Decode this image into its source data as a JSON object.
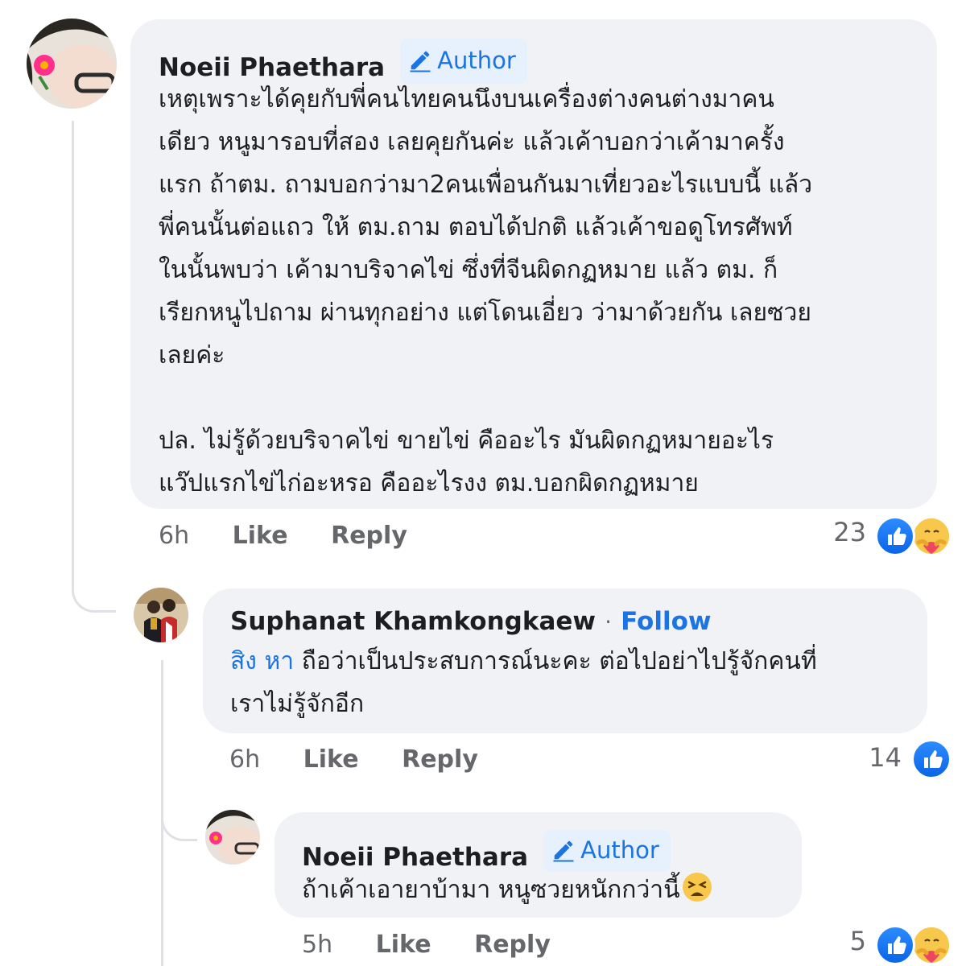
{
  "comments": [
    {
      "author": "Noeii Phaethara",
      "badge": "Author",
      "text": "เหตุเพราะได้คุยกับพี่คนไทยคนนึงบนเครื่องต่างคนต่างมาคน\nเดียว หนูมารอบที่สอง เลยคุยกันค่ะ แล้วเค้าบอกว่าเค้ามาครั้ง\nแรก ถ้าตม. ถามบอกว่ามา2คนเพื่อนกันมาเที่ยวอะไรแบบนี้ แล้ว\nพี่คนนั้นต่อแถว ให้ ตม.ถาม ตอบได้ปกติ แล้วเค้าขอดูโทรศัพท์\nในนั้นพบว่า เค้ามาบริจาคไข่ ซึ่งที่จีนผิดกฏหมาย แล้ว ตม. ก็\nเรียกหนูไปถาม ผ่านทุกอย่าง แต่โดนเอี่ยว ว่ามาด้วยกัน เลยซวย\nเลยค่ะ\n\nปล. ไม่รู้ด้วยบริจาคไข่ ขายไข่ คืออะไร มันผิดกฏหมายอะไร\nแว๊ปแรกไข่ไก่อะหรอ คืออะไรงง ตม.บอกผิดกฏหมาย",
      "time": "6h",
      "like": "Like",
      "reply": "Reply",
      "reaction_count": "23",
      "reactions": [
        "like-icon",
        "care-icon"
      ]
    },
    {
      "author": "Suphanat Khamkongkaew",
      "separator": "·",
      "follow": "Follow",
      "mention": "สิง หา",
      "text": " ถือว่าเป็นประสบการณ์นะคะ ต่อไปอย่าไปรู้จักคนที่\nเราไม่รู้จักอีก",
      "time": "6h",
      "like": "Like",
      "reply": "Reply",
      "reaction_count": "14",
      "reactions": [
        "like-icon"
      ]
    },
    {
      "author": "Noeii Phaethara",
      "badge": "Author",
      "text": "ถ้าเค้าเอายาบ้ามา หนูซวยหนักกว่านี้",
      "emoji": "weary-face-emoji",
      "time": "5h",
      "like": "Like",
      "reply": "Reply",
      "reaction_count": "5",
      "reactions": [
        "like-icon",
        "care-icon"
      ]
    }
  ]
}
